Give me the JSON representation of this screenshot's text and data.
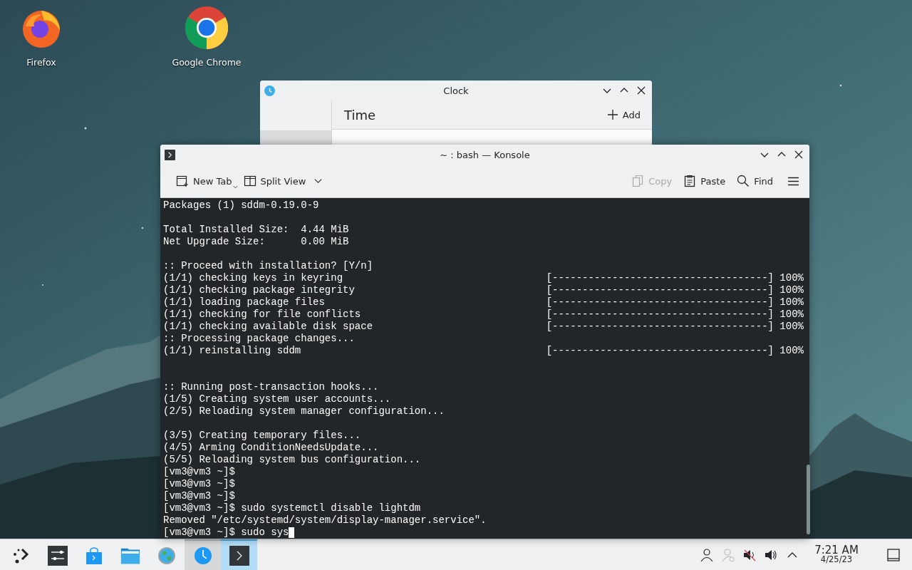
{
  "desktop_icons": [
    {
      "label": "Firefox"
    },
    {
      "label": "Google Chrome"
    }
  ],
  "clock_window": {
    "title": "Clock",
    "heading": "Time",
    "add_label": "Add"
  },
  "konsole": {
    "title": "~ : bash — Konsole",
    "toolbar": [
      {
        "label": "New Tab",
        "disabled": false
      },
      {
        "label": "Split View",
        "disabled": false
      },
      {
        "label": "Copy",
        "disabled": true
      },
      {
        "label": "Paste",
        "disabled": false
      },
      {
        "label": "Find",
        "disabled": false
      }
    ],
    "lines": [
      {
        "kind": "text",
        "text": "Packages (1) sddm-0.19.0-9"
      },
      {
        "kind": "blank"
      },
      {
        "kind": "text",
        "text": "Total Installed Size:  4.44 MiB"
      },
      {
        "kind": "text",
        "text": "Net Upgrade Size:      0.00 MiB"
      },
      {
        "kind": "blank"
      },
      {
        "kind": "text",
        "text": ":: Proceed with installation? [Y/n]"
      },
      {
        "kind": "progress",
        "text": "(1/1) checking keys in keyring",
        "bar": "[------------------------------------] 100%"
      },
      {
        "kind": "progress",
        "text": "(1/1) checking package integrity",
        "bar": "[------------------------------------] 100%"
      },
      {
        "kind": "progress",
        "text": "(1/1) loading package files",
        "bar": "[------------------------------------] 100%"
      },
      {
        "kind": "progress",
        "text": "(1/1) checking for file conflicts",
        "bar": "[------------------------------------] 100%"
      },
      {
        "kind": "progress",
        "text": "(1/1) checking available disk space",
        "bar": "[------------------------------------] 100%"
      },
      {
        "kind": "text",
        "text": ":: Processing package changes..."
      },
      {
        "kind": "progress",
        "text": "(1/1) reinstalling sddm",
        "bar": "[------------------------------------] 100%"
      },
      {
        "kind": "blank"
      },
      {
        "kind": "blank"
      },
      {
        "kind": "text",
        "text": ":: Running post-transaction hooks..."
      },
      {
        "kind": "text",
        "text": "(1/5) Creating system user accounts..."
      },
      {
        "kind": "text",
        "text": "(2/5) Reloading system manager configuration..."
      },
      {
        "kind": "blank"
      },
      {
        "kind": "text",
        "text": "(3/5) Creating temporary files..."
      },
      {
        "kind": "text",
        "text": "(4/5) Arming ConditionNeedsUpdate..."
      },
      {
        "kind": "text",
        "text": "(5/5) Reloading system bus configuration..."
      },
      {
        "kind": "text",
        "text": "[vm3@vm3 ~]$"
      },
      {
        "kind": "text",
        "text": "[vm3@vm3 ~]$"
      },
      {
        "kind": "text",
        "text": "[vm3@vm3 ~]$"
      },
      {
        "kind": "text",
        "text": "[vm3@vm3 ~]$ sudo systemctl disable lightdm"
      },
      {
        "kind": "text",
        "text": "Removed \"/etc/systemd/system/display-manager.service\"."
      },
      {
        "kind": "input",
        "text": "[vm3@vm3 ~]$ sudo sys"
      }
    ]
  },
  "taskbar": {
    "tasks": [
      {
        "open": false,
        "selected": false
      },
      {
        "open": false,
        "selected": false
      },
      {
        "open": false,
        "selected": false
      },
      {
        "open": false,
        "selected": false
      },
      {
        "open": false,
        "selected": false
      },
      {
        "open": true,
        "selected": false
      },
      {
        "open": true,
        "selected": true
      }
    ],
    "time": "7:21 AM",
    "date": "4/25/23"
  }
}
